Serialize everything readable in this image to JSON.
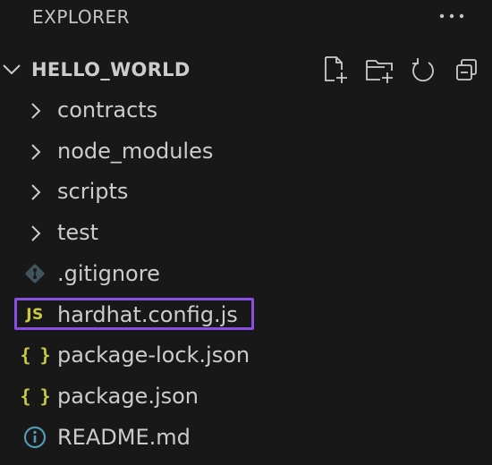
{
  "header": {
    "title": "EXPLORER",
    "more_icon": "ellipsis-icon"
  },
  "folder": {
    "name": "HELLO_WORLD",
    "expanded": true,
    "actions": [
      {
        "icon": "new-file-icon"
      },
      {
        "icon": "new-folder-icon"
      },
      {
        "icon": "refresh-icon"
      },
      {
        "icon": "collapse-all-icon"
      }
    ]
  },
  "tree": {
    "folders": [
      {
        "label": "contracts"
      },
      {
        "label": "node_modules"
      },
      {
        "label": "scripts"
      },
      {
        "label": "test"
      }
    ],
    "files": [
      {
        "label": ".gitignore",
        "icon": "git-icon"
      },
      {
        "label": "hardhat.config.js",
        "icon": "javascript-file-icon",
        "icon_text": "JS",
        "highlighted": true
      },
      {
        "label": "package-lock.json",
        "icon": "json-file-icon",
        "icon_text": "{ }"
      },
      {
        "label": "package.json",
        "icon": "json-file-icon",
        "icon_text": "{ }"
      },
      {
        "label": "README.md",
        "icon": "info-icon"
      }
    ]
  },
  "colors": {
    "background": "#181818",
    "text": "#cccccc",
    "highlight_border": "#8a4fe0",
    "json_js_icon": "#cbcb41",
    "git_icon": "#41535b",
    "info_icon": "#519aba"
  }
}
